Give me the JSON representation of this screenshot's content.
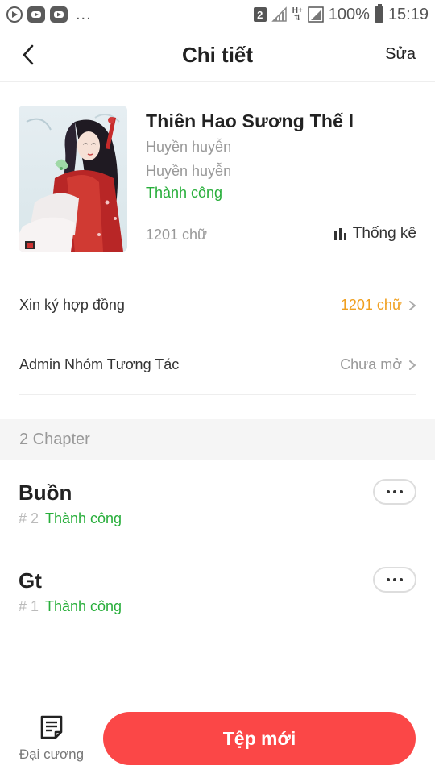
{
  "status_bar": {
    "sim": "2",
    "network": "H+",
    "battery": "100%",
    "time": "15:19",
    "dots": "..."
  },
  "header": {
    "title": "Chi tiết",
    "edit_label": "Sửa"
  },
  "book": {
    "title": "Thiên Hao Sương Thế I",
    "genre1": "Huyền huyễn",
    "genre2": "Huyền huyễn",
    "status": "Thành công",
    "word_count": "1201 chữ",
    "stats_label": "Thống kê"
  },
  "rows": {
    "contract_label": "Xin ký hợp đồng",
    "contract_value": "1201 chữ",
    "admin_label": "Admin Nhóm Tương Tác",
    "admin_value": "Chưa mở"
  },
  "section": {
    "chapters_header": "2 Chapter"
  },
  "chapters": [
    {
      "title": "Buồn",
      "num": "# 2",
      "status": "Thành công"
    },
    {
      "title": "Gt",
      "num": "# 1",
      "status": "Thành công"
    }
  ],
  "bottom": {
    "outline_label": "Đại cương",
    "new_label": "Tệp mới"
  },
  "colors": {
    "accent_red": "#fb4747",
    "success_green": "#27ae3a",
    "value_orange": "#f0a020"
  }
}
